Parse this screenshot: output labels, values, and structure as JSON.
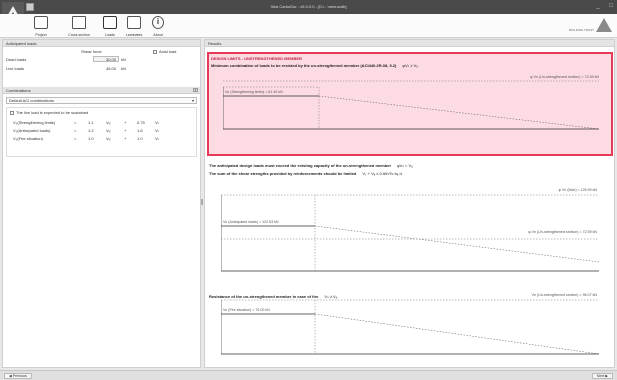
{
  "window": {
    "title": "Sika CarboDur - v5.0.0.0 - [D:\\...\\new.scdb]",
    "minimize": "_",
    "maximize": "□"
  },
  "ribbon": {
    "buttons": [
      {
        "label": "Project",
        "icon": "project-icon"
      },
      {
        "label": "Cross section",
        "icon": "cross-section-icon"
      },
      {
        "label": "Loads",
        "icon": "loads-icon"
      },
      {
        "label": "Laminates",
        "icon": "laminates-icon"
      },
      {
        "label": "About",
        "icon": "info-icon"
      }
    ],
    "brand": "BUILDING TRUST"
  },
  "anticipated": {
    "title": "Anticipated loads",
    "col_header": "Shear force",
    "axial_label": "Axial load",
    "dead_label": "Dead loads",
    "dead_value": "30.00",
    "dead_unit": "kN",
    "live_label": "Live loads",
    "live_value": "45.00",
    "live_unit": "kN"
  },
  "combinations": {
    "title": "Combinations",
    "selected": "Default ACI combinations",
    "sustain_label": "The live load is expected to be sustained",
    "rows": [
      {
        "label": "V₀(Strengthening limits)",
        "eq": "=",
        "c1": "1.1",
        "g": "Vₒₗ",
        "plus": "+",
        "c2": "0.75",
        "q": "Vₗₗ"
      },
      {
        "label": "V₀(Anticipated loads)",
        "eq": "=",
        "c1": "1.2",
        "g": "Vₒₗ",
        "plus": "+",
        "c2": "1.6",
        "q": "Vₗₗ"
      },
      {
        "label": "V₀(Fire situation)",
        "eq": "=",
        "c1": "1.0",
        "g": "Vₒₗ",
        "plus": "+",
        "c2": "1.0",
        "q": "Vₗₗ"
      }
    ]
  },
  "results": {
    "title": "Results",
    "design_heading": "DESIGN LIMITS - UNSTRENGTHENED MEMBER",
    "design_sub": "Minimum combination of loads to be resisted by the un-strengthened member (ACI440.2R-08, 9.2)",
    "design_math": "φVₙ ≥ Vᵤ",
    "d1_top": "φ Vn (Un-strengthened section) = 72.59 kN",
    "d1_left": "Vu (Strengthening limits) = 61.49 kN",
    "anticipated_sub1": "The anticipated design loads must exceed the existing capacity of the un-strengthened member",
    "anticipated_math1": "φVₙ < Vᵤ",
    "anticipated_sub2": "The sum of the shear strengths provided by reinforcements should be limited",
    "anticipated_math2": "Vₛ + Vₑ ≤ 0.66√f'c bₑ d",
    "d2_top": "φ Vn (Max) = 125.59 kN",
    "d2_left": "Vu (Anticipated loads) = 122.53 kN",
    "d2_right": "φ Vn (Un-strengthened section) = 72.59 kN",
    "fire_sub": "Resistance of the un-strengthened member in case of fire",
    "fire_math": "Vₙ ≥ Vᵤ",
    "d3_top": "Vn (Un-strengthened section) = 96.07 kN",
    "d3_left": "Vu (Fire situation) = 75.00 kN"
  },
  "nav": {
    "previous": "◀ Previous",
    "next": "Next ▶"
  }
}
